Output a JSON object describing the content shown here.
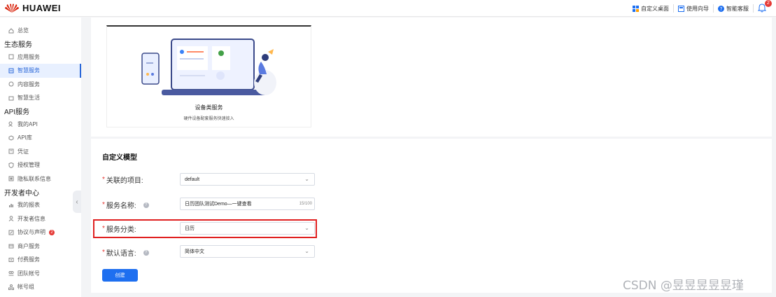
{
  "header": {
    "brand": "HUAWEI",
    "links": [
      {
        "label": "自定义桌面",
        "icon": "grid-icon"
      },
      {
        "label": "使用向导",
        "icon": "guide-icon"
      },
      {
        "label": "智能客服",
        "icon": "help-icon"
      }
    ],
    "notification_count": "2"
  },
  "sidebar": {
    "overview": "总览",
    "groups": [
      {
        "title": "生态服务",
        "items": [
          {
            "label": "应用服务"
          },
          {
            "label": "智慧服务",
            "active": true
          },
          {
            "label": "内容服务"
          },
          {
            "label": "智慧生活"
          }
        ]
      },
      {
        "title": "API服务",
        "items": [
          {
            "label": "我的API"
          },
          {
            "label": "API库"
          },
          {
            "label": "凭证"
          },
          {
            "label": "授权管理"
          },
          {
            "label": "隐私联系信息"
          }
        ]
      },
      {
        "title": "开发者中心",
        "items": [
          {
            "label": "我的报表"
          },
          {
            "label": "开发者信息"
          },
          {
            "label": "协议与声明",
            "badge": "2"
          },
          {
            "label": "商户服务"
          },
          {
            "label": "付费服务"
          },
          {
            "label": "团队帐号"
          },
          {
            "label": "帐号组"
          }
        ]
      }
    ]
  },
  "card": {
    "title": "设备类服务",
    "subtitle": "硬件设备配套服务快速接入"
  },
  "form": {
    "title": "自定义模型",
    "fields": {
      "project": {
        "label": "关联的项目:",
        "value": "default"
      },
      "name": {
        "label": "服务名称:",
        "value": "日历团队测试Demo—一键查看",
        "count": "15/100"
      },
      "category": {
        "label": "服务分类:",
        "value": "日历"
      },
      "language": {
        "label": "默认语言:",
        "value": "简体中文"
      }
    },
    "submit": "创建"
  },
  "watermark": "CSDN @昱昱昱昱昱瑾",
  "colors": {
    "accent": "#1e6ff0",
    "highlight": "#e02020",
    "required": "#e53935"
  }
}
